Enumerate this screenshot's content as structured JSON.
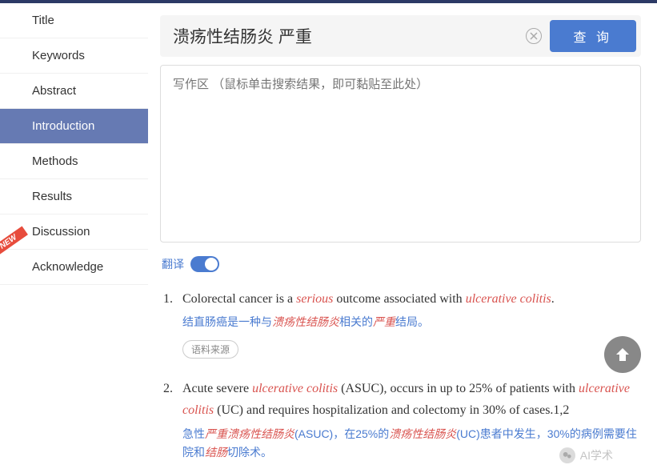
{
  "sidebar": {
    "items": [
      {
        "label": "Title"
      },
      {
        "label": "Keywords"
      },
      {
        "label": "Abstract"
      },
      {
        "label": "Introduction"
      },
      {
        "label": "Methods"
      },
      {
        "label": "Results"
      },
      {
        "label": "Discussion"
      },
      {
        "label": "Acknowledge"
      }
    ],
    "active_index": 3,
    "new_badge": "NEW"
  },
  "search": {
    "value": "溃疡性结肠炎 严重",
    "button_label": "查 询"
  },
  "textarea": {
    "placeholder": "写作区 （鼠标单击搜索结果，即可黏贴至此处）"
  },
  "translate": {
    "label": "翻译",
    "on": true
  },
  "results": [
    {
      "num": "1.",
      "en_parts": [
        {
          "t": "Colorectal cancer is a ",
          "h": false
        },
        {
          "t": "serious",
          "h": true
        },
        {
          "t": " outcome associated with ",
          "h": false
        },
        {
          "t": "ulcerative colitis",
          "h": true
        },
        {
          "t": ".",
          "h": false
        }
      ],
      "zh_parts": [
        {
          "t": "结直肠癌是一种与",
          "h": false
        },
        {
          "t": "溃疡性结肠炎",
          "h": true
        },
        {
          "t": "相关的",
          "h": false
        },
        {
          "t": "严重",
          "h": true
        },
        {
          "t": "结局。",
          "h": false
        }
      ],
      "source_label": "语料来源"
    },
    {
      "num": "2.",
      "en_parts": [
        {
          "t": "Acute severe ",
          "h": false
        },
        {
          "t": "ulcerative colitis",
          "h": true
        },
        {
          "t": " (ASUC), occurs in up to 25% of patients with ",
          "h": false
        },
        {
          "t": "ulcerative colitis",
          "h": true
        },
        {
          "t": " (UC) and requires hospitalization and colectomy in 30% of cases.1,2",
          "h": false
        }
      ],
      "zh_parts": [
        {
          "t": "急性",
          "h": false
        },
        {
          "t": "严重溃疡性结肠炎",
          "h": true
        },
        {
          "t": "(ASUC)，在25%的",
          "h": false
        },
        {
          "t": "溃疡性结肠炎",
          "h": true
        },
        {
          "t": "(UC)患者中发生，30%的病例需要住院和",
          "h": false
        },
        {
          "t": "结肠",
          "h": true
        },
        {
          "t": "切除术。",
          "h": false
        }
      ]
    }
  ],
  "watermark": "AI学术"
}
